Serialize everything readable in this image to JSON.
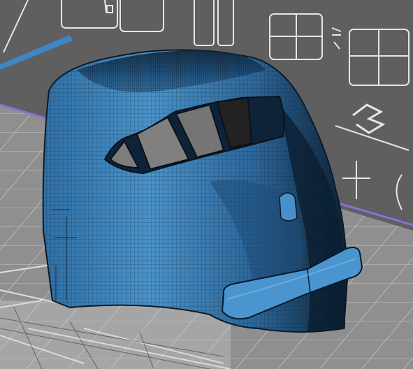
{
  "scene": {
    "description_icon": "3d-train-cab-mesh",
    "colors": {
      "background_wall": "#5f5f5f",
      "wall_lines": "#e6e6e6",
      "floor": "#8f8f8f",
      "floor_lines": "#d9d9d9",
      "mesh_base": "#3a7fb6",
      "mesh_dark": "#0b1f33",
      "mesh_highlight": "#5aa3d8",
      "horizon_line": "#8b6fd6"
    }
  }
}
